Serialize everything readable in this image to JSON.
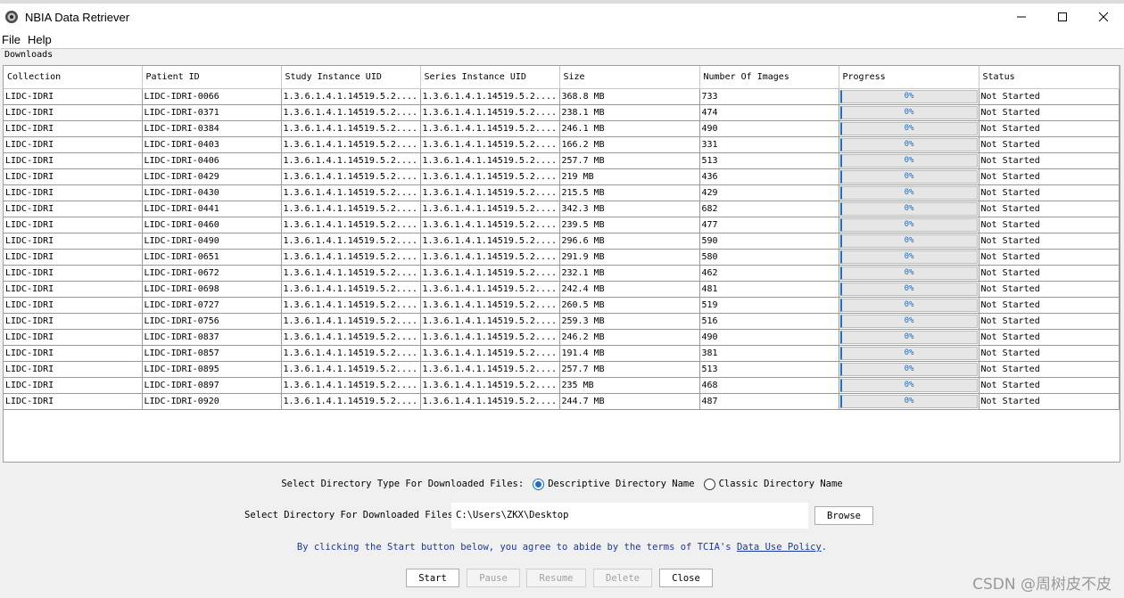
{
  "window": {
    "title": "NBIA Data Retriever"
  },
  "menu": [
    "File",
    "Help"
  ],
  "panel": {
    "title": "Downloads"
  },
  "table": {
    "columns": [
      "Collection",
      "Patient ID",
      "Study Instance UID",
      "Series Instance UID",
      "Size",
      "Number Of Images",
      "Progress",
      "Status"
    ],
    "rows": [
      {
        "collection": "LIDC-IDRI",
        "patient": "LIDC-IDRI-0066",
        "study": "1.3.6.1.4.1.14519.5.2....",
        "series": "1.3.6.1.4.1.14519.5.2....",
        "size": "368.8 MB",
        "images": "733",
        "progress": "0%",
        "progress_value": 0,
        "status": "Not Started"
      },
      {
        "collection": "LIDC-IDRI",
        "patient": "LIDC-IDRI-0371",
        "study": "1.3.6.1.4.1.14519.5.2....",
        "series": "1.3.6.1.4.1.14519.5.2....",
        "size": "238.1 MB",
        "images": "474",
        "progress": "0%",
        "progress_value": 0,
        "status": "Not Started"
      },
      {
        "collection": "LIDC-IDRI",
        "patient": "LIDC-IDRI-0384",
        "study": "1.3.6.1.4.1.14519.5.2....",
        "series": "1.3.6.1.4.1.14519.5.2....",
        "size": "246.1 MB",
        "images": "490",
        "progress": "0%",
        "progress_value": 0,
        "status": "Not Started"
      },
      {
        "collection": "LIDC-IDRI",
        "patient": "LIDC-IDRI-0403",
        "study": "1.3.6.1.4.1.14519.5.2....",
        "series": "1.3.6.1.4.1.14519.5.2....",
        "size": "166.2 MB",
        "images": "331",
        "progress": "0%",
        "progress_value": 0,
        "status": "Not Started"
      },
      {
        "collection": "LIDC-IDRI",
        "patient": "LIDC-IDRI-0406",
        "study": "1.3.6.1.4.1.14519.5.2....",
        "series": "1.3.6.1.4.1.14519.5.2....",
        "size": "257.7 MB",
        "images": "513",
        "progress": "0%",
        "progress_value": 0,
        "status": "Not Started"
      },
      {
        "collection": "LIDC-IDRI",
        "patient": "LIDC-IDRI-0429",
        "study": "1.3.6.1.4.1.14519.5.2....",
        "series": "1.3.6.1.4.1.14519.5.2....",
        "size": "219 MB",
        "images": "436",
        "progress": "0%",
        "progress_value": 0,
        "status": "Not Started"
      },
      {
        "collection": "LIDC-IDRI",
        "patient": "LIDC-IDRI-0430",
        "study": "1.3.6.1.4.1.14519.5.2....",
        "series": "1.3.6.1.4.1.14519.5.2....",
        "size": "215.5 MB",
        "images": "429",
        "progress": "0%",
        "progress_value": 0,
        "status": "Not Started"
      },
      {
        "collection": "LIDC-IDRI",
        "patient": "LIDC-IDRI-0441",
        "study": "1.3.6.1.4.1.14519.5.2....",
        "series": "1.3.6.1.4.1.14519.5.2....",
        "size": "342.3 MB",
        "images": "682",
        "progress": "0%",
        "progress_value": 0,
        "status": "Not Started"
      },
      {
        "collection": "LIDC-IDRI",
        "patient": "LIDC-IDRI-0460",
        "study": "1.3.6.1.4.1.14519.5.2....",
        "series": "1.3.6.1.4.1.14519.5.2....",
        "size": "239.5 MB",
        "images": "477",
        "progress": "0%",
        "progress_value": 0,
        "status": "Not Started"
      },
      {
        "collection": "LIDC-IDRI",
        "patient": "LIDC-IDRI-0490",
        "study": "1.3.6.1.4.1.14519.5.2....",
        "series": "1.3.6.1.4.1.14519.5.2....",
        "size": "296.6 MB",
        "images": "590",
        "progress": "0%",
        "progress_value": 0,
        "status": "Not Started"
      },
      {
        "collection": "LIDC-IDRI",
        "patient": "LIDC-IDRI-0651",
        "study": "1.3.6.1.4.1.14519.5.2....",
        "series": "1.3.6.1.4.1.14519.5.2....",
        "size": "291.9 MB",
        "images": "580",
        "progress": "0%",
        "progress_value": 0,
        "status": "Not Started"
      },
      {
        "collection": "LIDC-IDRI",
        "patient": "LIDC-IDRI-0672",
        "study": "1.3.6.1.4.1.14519.5.2....",
        "series": "1.3.6.1.4.1.14519.5.2....",
        "size": "232.1 MB",
        "images": "462",
        "progress": "0%",
        "progress_value": 0,
        "status": "Not Started"
      },
      {
        "collection": "LIDC-IDRI",
        "patient": "LIDC-IDRI-0698",
        "study": "1.3.6.1.4.1.14519.5.2....",
        "series": "1.3.6.1.4.1.14519.5.2....",
        "size": "242.4 MB",
        "images": "481",
        "progress": "0%",
        "progress_value": 0,
        "status": "Not Started"
      },
      {
        "collection": "LIDC-IDRI",
        "patient": "LIDC-IDRI-0727",
        "study": "1.3.6.1.4.1.14519.5.2....",
        "series": "1.3.6.1.4.1.14519.5.2....",
        "size": "260.5 MB",
        "images": "519",
        "progress": "0%",
        "progress_value": 0,
        "status": "Not Started"
      },
      {
        "collection": "LIDC-IDRI",
        "patient": "LIDC-IDRI-0756",
        "study": "1.3.6.1.4.1.14519.5.2....",
        "series": "1.3.6.1.4.1.14519.5.2....",
        "size": "259.3 MB",
        "images": "516",
        "progress": "0%",
        "progress_value": 0,
        "status": "Not Started"
      },
      {
        "collection": "LIDC-IDRI",
        "patient": "LIDC-IDRI-0837",
        "study": "1.3.6.1.4.1.14519.5.2....",
        "series": "1.3.6.1.4.1.14519.5.2....",
        "size": "246.2 MB",
        "images": "490",
        "progress": "0%",
        "progress_value": 0,
        "status": "Not Started"
      },
      {
        "collection": "LIDC-IDRI",
        "patient": "LIDC-IDRI-0857",
        "study": "1.3.6.1.4.1.14519.5.2....",
        "series": "1.3.6.1.4.1.14519.5.2....",
        "size": "191.4 MB",
        "images": "381",
        "progress": "0%",
        "progress_value": 0,
        "status": "Not Started"
      },
      {
        "collection": "LIDC-IDRI",
        "patient": "LIDC-IDRI-0895",
        "study": "1.3.6.1.4.1.14519.5.2....",
        "series": "1.3.6.1.4.1.14519.5.2....",
        "size": "257.7 MB",
        "images": "513",
        "progress": "0%",
        "progress_value": 0,
        "status": "Not Started"
      },
      {
        "collection": "LIDC-IDRI",
        "patient": "LIDC-IDRI-0897",
        "study": "1.3.6.1.4.1.14519.5.2....",
        "series": "1.3.6.1.4.1.14519.5.2....",
        "size": "235 MB",
        "images": "468",
        "progress": "0%",
        "progress_value": 0,
        "status": "Not Started"
      },
      {
        "collection": "LIDC-IDRI",
        "patient": "LIDC-IDRI-0920",
        "study": "1.3.6.1.4.1.14519.5.2....",
        "series": "1.3.6.1.4.1.14519.5.2....",
        "size": "244.7 MB",
        "images": "487",
        "progress": "0%",
        "progress_value": 0,
        "status": "Not Started"
      }
    ]
  },
  "options": {
    "label": "Select Directory Type For Downloaded Files:",
    "descriptive": "Descriptive Directory Name",
    "classic": "Classic Directory Name",
    "selected": "descriptive"
  },
  "directory": {
    "label": "Select Directory For Downloaded Files:",
    "value": "C:\\Users\\ZKX\\Desktop",
    "browse_label": "Browse"
  },
  "policy": {
    "text": "By clicking the Start button below,  you agree to abide by the terms of TCIA's ",
    "link": "Data Use Policy",
    "suffix": "."
  },
  "buttons": {
    "start": "Start",
    "pause": "Pause",
    "resume": "Resume",
    "delete": "Delete",
    "close": "Close"
  },
  "watermark": "CSDN @周树皮不皮",
  "colors": {
    "accent": "#1a6fc4",
    "progress_bg": "#e6e6e6",
    "link": "#1a3aa0"
  }
}
